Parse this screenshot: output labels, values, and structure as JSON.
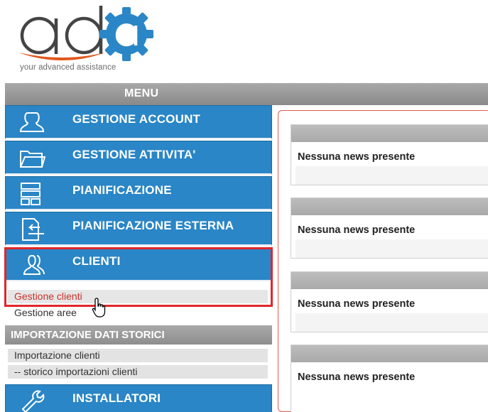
{
  "brand": {
    "tagline": "your advanced assistance",
    "colors": {
      "dark_text": "#444444",
      "accent_blue": "#2a86c6",
      "swoosh_orange": "#e2571e"
    }
  },
  "menu": {
    "title": "MENU"
  },
  "nav": {
    "items": [
      {
        "label": "GESTIONE ACCOUNT",
        "icon": "user-icon"
      },
      {
        "label": "GESTIONE ATTIVITA'",
        "icon": "folder-icon"
      },
      {
        "label": "PIANIFICAZIONE",
        "icon": "layout-icon"
      },
      {
        "label": "PIANIFICAZIONE ESTERNA",
        "icon": "external-planning-icon"
      },
      {
        "label": "CLIENTI",
        "icon": "users-icon"
      }
    ],
    "clienti_sub": [
      "Gestione clienti",
      "Gestione aree"
    ],
    "importazione": {
      "title": "IMPORTAZIONE DATI STORICI",
      "items": [
        "Importazione clienti",
        "-- storico importazioni clienti"
      ]
    },
    "installatori": {
      "label": "INSTALLATORI",
      "icon": "wrench-icon"
    }
  },
  "news": [
    {
      "text": "Nessuna news presente"
    },
    {
      "text": "Nessuna news presente"
    },
    {
      "text": "Nessuna news presente"
    },
    {
      "text": "Nessuna news presente"
    }
  ],
  "highlight": {
    "color": "#e1262b"
  }
}
